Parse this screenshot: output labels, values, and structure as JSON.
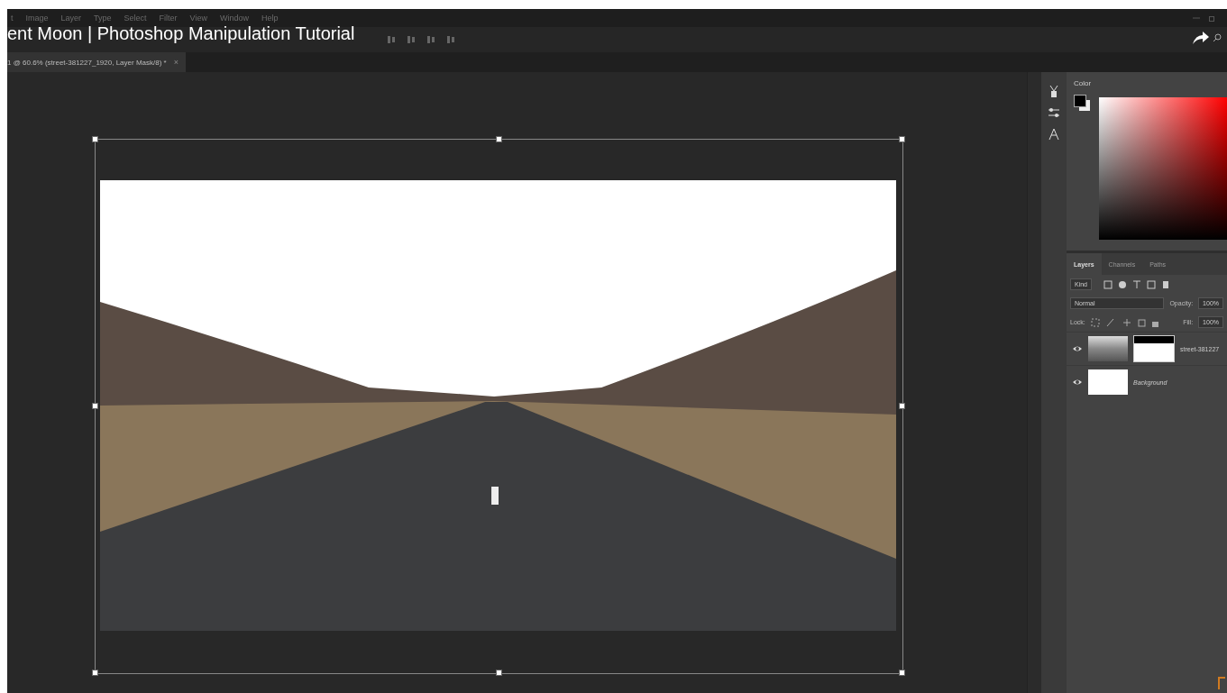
{
  "menu": [
    "t",
    "Image",
    "Layer",
    "Type",
    "Select",
    "Filter",
    "View",
    "Window",
    "Help"
  ],
  "video_title": "ent Moon | Photoshop Manipulation Tutorial",
  "document_tab": {
    "title": "1 @ 60.6% (street-381227_1920, Layer Mask/8) *",
    "close": "×"
  },
  "color_panel": {
    "title": "Color"
  },
  "layers_panel": {
    "tabs": [
      {
        "label": "Layers",
        "selected": true
      },
      {
        "label": "Channels",
        "selected": false
      },
      {
        "label": "Paths",
        "selected": false
      }
    ],
    "filter": "Kind",
    "blend_mode": "Normal",
    "opacity_label": "Opacity:",
    "opacity": "100%",
    "lock_label": "Lock:",
    "fill_label": "Fill:",
    "fill": "100%",
    "layers": [
      {
        "name": "street-381227",
        "kind": "masked",
        "visible": true
      },
      {
        "name": "Background",
        "kind": "background",
        "visible": true
      }
    ]
  }
}
